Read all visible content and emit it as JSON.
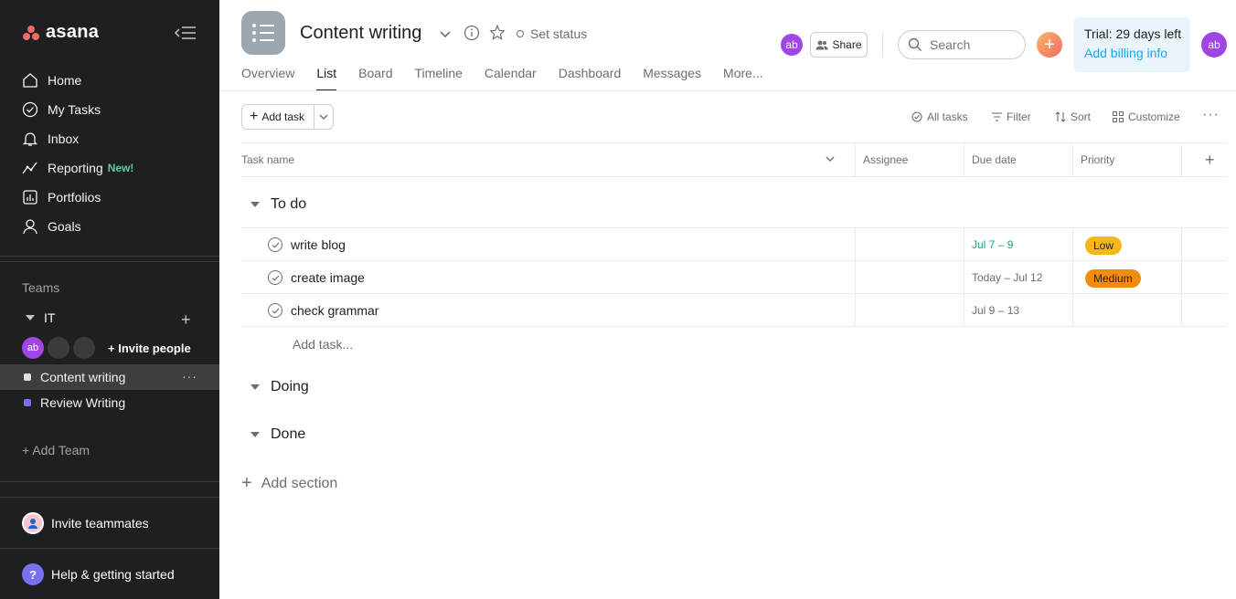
{
  "app": {
    "name": "asana"
  },
  "sidebar": {
    "nav": [
      {
        "label": "Home",
        "icon": "home-icon"
      },
      {
        "label": "My Tasks",
        "icon": "check-circle-icon"
      },
      {
        "label": "Inbox",
        "icon": "bell-icon"
      },
      {
        "label": "Reporting",
        "icon": "chart-line-icon",
        "badge": "New!"
      },
      {
        "label": "Portfolios",
        "icon": "portfolio-icon"
      },
      {
        "label": "Goals",
        "icon": "person-icon"
      }
    ],
    "teams_label": "Teams",
    "team": {
      "name": "IT"
    },
    "members": [
      {
        "initials": "ab",
        "color": "#9f46e4"
      }
    ],
    "invite_people": "Invite people",
    "projects": [
      {
        "name": "Content writing",
        "color": "#e0e0e0",
        "active": true
      },
      {
        "name": "Review Writing",
        "color": "#7a6ff0",
        "active": false
      }
    ],
    "add_team": "Add Team",
    "invite_teammates": "Invite teammates",
    "help": "Help & getting started"
  },
  "header": {
    "project_title": "Content writing",
    "set_status": "Set status",
    "tabs": [
      "Overview",
      "List",
      "Board",
      "Timeline",
      "Calendar",
      "Dashboard",
      "Messages",
      "More..."
    ],
    "active_tab": "List",
    "avatar_initials": "ab",
    "share_label": "Share",
    "search_placeholder": "Search",
    "trial_text": "Trial: 29 days left",
    "billing_link": "Add billing info",
    "user_initials": "ab"
  },
  "toolbar": {
    "add_task": "Add task",
    "all_tasks": "All tasks",
    "filter": "Filter",
    "sort": "Sort",
    "customize": "Customize"
  },
  "table": {
    "columns": [
      "Task name",
      "Assignee",
      "Due date",
      "Priority"
    ],
    "sections": [
      {
        "title": "To do",
        "tasks": [
          {
            "name": "write blog",
            "due": "Jul 7 – 9",
            "due_color": "#14a38b",
            "priority": "Low",
            "priority_color": "#f8b719"
          },
          {
            "name": "create image",
            "due": "Today – Jul 12",
            "due_color": "#6d6e6f",
            "priority": "Medium",
            "priority_color": "#f28c0f"
          },
          {
            "name": "check grammar",
            "due": "Jul 9 – 13",
            "due_color": "#6d6e6f",
            "priority": "",
            "priority_color": ""
          }
        ],
        "add_task": "Add task..."
      },
      {
        "title": "Doing",
        "tasks": []
      },
      {
        "title": "Done",
        "tasks": []
      }
    ],
    "add_section": "Add section"
  }
}
